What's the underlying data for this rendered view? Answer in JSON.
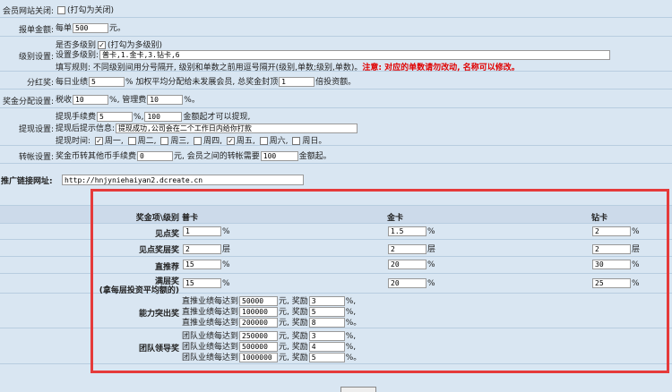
{
  "site_close": {
    "label": "会员网站关闭:",
    "hint": "(打勾为关闭)"
  },
  "report_amount": {
    "label": "报单金额:",
    "prefix": "每单",
    "value": "500",
    "suffix": "元。"
  },
  "level": {
    "label": "级别设置:",
    "multi_prefix": "是否多级别",
    "multi_hint": "(打勾为多级别)",
    "setting_prefix": "设置多级别:",
    "setting_value": "普卡,1.金卡,3.钻卡,6",
    "rule_text": "填写规则: 不同级别间用分号隔开, 级别和单数之前用逗号隔开(级别,单数;级别,单数)。",
    "warning": "注意: 对应的单数请勿改动, 名称可以修改。"
  },
  "dividend": {
    "label": "分红奖:",
    "p1": "每日业绩",
    "value1": "5",
    "p2": "% 加权平均分配给未发展会员, 总奖金封顶",
    "value2": "1",
    "p3": "倍投资额。"
  },
  "bonus_dist": {
    "label": "奖金分配设置:",
    "p1": "税收",
    "tax": "10",
    "p2": "%, 管理费",
    "fee": "10",
    "p3": "%。"
  },
  "withdraw": {
    "label": "提现设置:",
    "fee_prefix": "提现手续费",
    "fee": "5",
    "fee_mid": "%,",
    "min": "100",
    "fee_suffix": "金额起才可以提现,",
    "msg_prefix": "提现后提示信息:",
    "msg_value": "提现成功,公司会在二个工作日内给你打款",
    "time_prefix": "提现时间:",
    "days": [
      {
        "label": "周一,",
        "checked": "✓"
      },
      {
        "label": "周二,",
        "checked": ""
      },
      {
        "label": "周三,",
        "checked": ""
      },
      {
        "label": "周四,",
        "checked": ""
      },
      {
        "label": "周五,",
        "checked": "✓"
      },
      {
        "label": "周六,",
        "checked": ""
      },
      {
        "label": "周日。",
        "checked": ""
      }
    ]
  },
  "transfer": {
    "label": "转帐设置:",
    "p1": "奖金币转其他币手续费",
    "fee": "0",
    "p2": "元, 会员之间的转帐需要",
    "min": "100",
    "p3": "金额起。"
  },
  "promo": {
    "label": "推广链接网址:",
    "url": "http://hnjyniehaiyan2.dcreate.cn"
  },
  "bonus_table": {
    "header": {
      "col0": "奖金项\\级别",
      "col1": "普卡",
      "col2": "金卡",
      "col3": "钻卡"
    },
    "rows": [
      {
        "label": "见点奖",
        "v1": "1",
        "v2": "1.5",
        "v3": "2",
        "unit": "%"
      },
      {
        "label": "见点奖层奖",
        "v1": "2",
        "v2": "2",
        "v3": "2",
        "unit": "层"
      },
      {
        "label": "直推荐",
        "v1": "15",
        "v2": "20",
        "v3": "30",
        "unit": "%"
      },
      {
        "label": "满层奖",
        "label2": "(拿每层投资平均额的)",
        "v1": "15",
        "v2": "20",
        "v3": "25",
        "unit": "%"
      }
    ],
    "ability": {
      "label": "能力突出奖",
      "lines": [
        {
          "prefix": "直推业绩每达到",
          "amount": "50000",
          "mid": "元, 奖励",
          "reward": "3",
          "suffix": "%,"
        },
        {
          "prefix": "直推业绩每达到",
          "amount": "100000",
          "mid": "元, 奖励",
          "reward": "5",
          "suffix": "%,"
        },
        {
          "prefix": "直推业绩每达到",
          "amount": "200000",
          "mid": "元, 奖励",
          "reward": "8",
          "suffix": "%。"
        }
      ]
    },
    "team": {
      "label": "团队领导奖",
      "lines": [
        {
          "prefix": "团队业绩每达到",
          "amount": "250000",
          "mid": "元, 奖励",
          "reward": "3",
          "suffix": "%,"
        },
        {
          "prefix": "团队业绩每达到",
          "amount": "500000",
          "mid": "元, 奖励",
          "reward": "4",
          "suffix": "%,"
        },
        {
          "prefix": "团队业绩每达到",
          "amount": "1000000",
          "mid": "元, 奖励",
          "reward": "5",
          "suffix": "%。"
        }
      ]
    }
  },
  "colors": {
    "highlight_border": "#e53a3a",
    "background": "#d9e6f2",
    "warning": "#e00000"
  }
}
